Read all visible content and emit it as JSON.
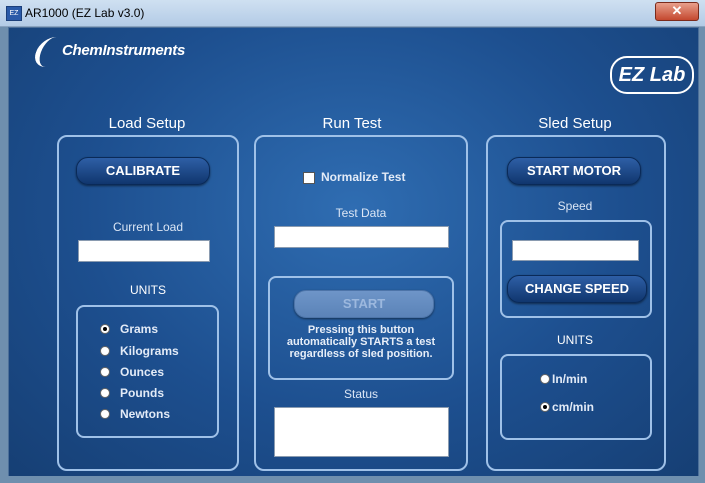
{
  "window": {
    "title": "AR1000 (EZ Lab v3.0)",
    "app_icon": "EZ",
    "close_label": "✕"
  },
  "logos": {
    "left": "ChemInstruments",
    "right": "EZ Lab"
  },
  "load_setup": {
    "title": "Load Setup",
    "calibrate_label": "CALIBRATE",
    "current_load_label": "Current Load",
    "current_load_value": "",
    "units_label": "UNITS",
    "units": [
      {
        "label": "Grams",
        "selected": true
      },
      {
        "label": "Kilograms",
        "selected": false
      },
      {
        "label": "Ounces",
        "selected": false
      },
      {
        "label": "Pounds",
        "selected": false
      },
      {
        "label": "Newtons",
        "selected": false
      }
    ]
  },
  "run_test": {
    "title": "Run Test",
    "normalize_label": "Normalize Test",
    "normalize_checked": false,
    "test_data_label": "Test Data",
    "test_data_value": "",
    "start_label": "START",
    "start_info": "Pressing this button automatically STARTS a test regardless of sled position.",
    "status_label": "Status",
    "status_value": ""
  },
  "sled_setup": {
    "title": "Sled Setup",
    "start_motor_label": "START MOTOR",
    "speed_label": "Speed",
    "speed_value": "",
    "change_speed_label": "CHANGE SPEED",
    "units_label": "UNITS",
    "units": [
      {
        "label": "In/min",
        "selected": false
      },
      {
        "label": "cm/min",
        "selected": true
      }
    ]
  }
}
